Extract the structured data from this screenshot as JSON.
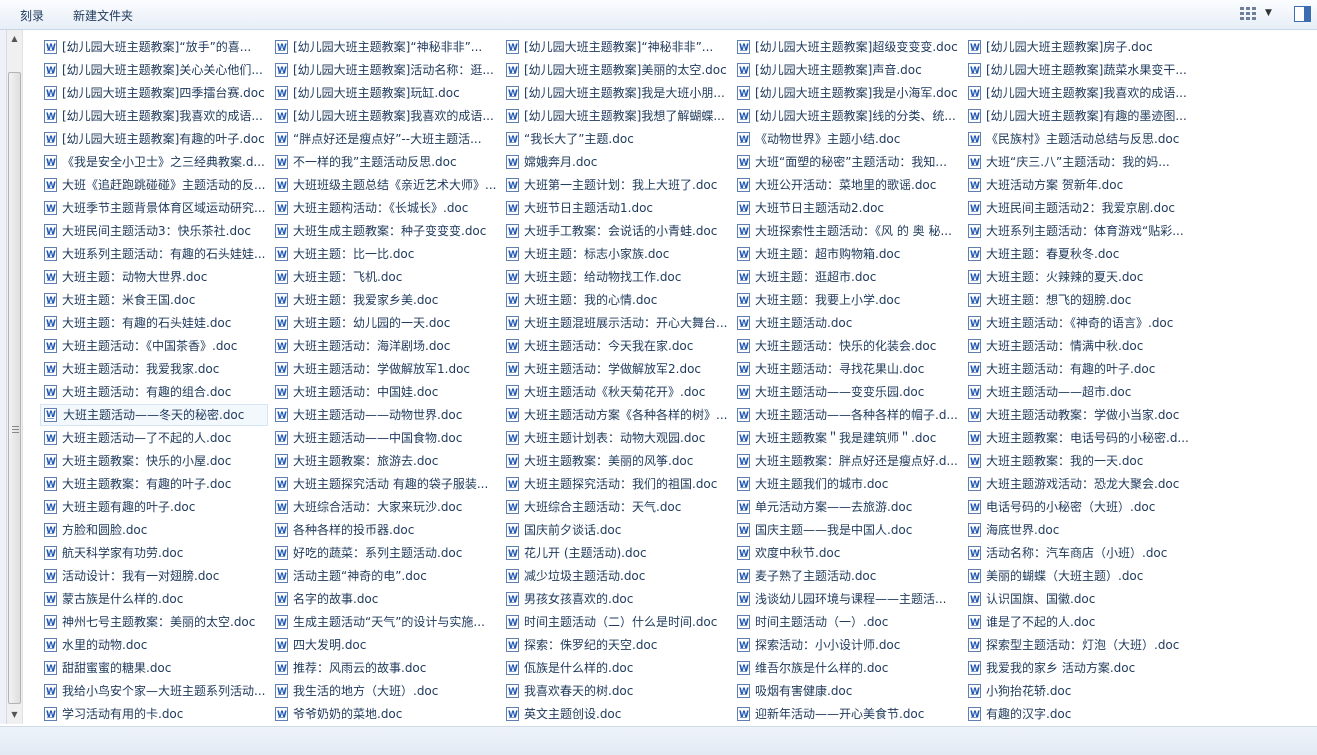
{
  "toolbar": {
    "burn_label": "刻录",
    "new_folder_label": "新建文件夹",
    "view_icon": "grid-view-icon",
    "view_menu_icon": "chevron-down-icon",
    "preview_pane_icon": "preview-pane-icon"
  },
  "selected_index": 16,
  "files": [
    "[幼儿园大班主题教案]“放手”的喜...",
    "[幼儿园大班主题教案]关心关心他们...",
    "[幼儿园大班主题教案]四季擂台赛.doc",
    "[幼儿园大班主题教案]我喜欢的成语...",
    "[幼儿园大班主题教案]有趣的叶子.doc",
    "《我是安全小卫士》之三经典教案.d...",
    "大班《追赶跑跳碰碰》主题活动的反...",
    "大班季节主题背景体育区域运动研究...",
    "大班民间主题活动3：快乐茶社.doc",
    "大班系列主题活动：有趣的石头娃娃...",
    "大班主题：动物大世界.doc",
    "大班主题：米食王国.doc",
    "大班主题：有趣的石头娃娃.doc",
    "大班主题活动：《中国茶香》.doc",
    "大班主题活动：我爱我家.doc",
    "大班主题活动：有趣的组合.doc",
    "大班主题活动——冬天的秘密.doc",
    "大班主题活动—了不起的人.doc",
    "大班主题教案：快乐的小屋.doc",
    "大班主题教案：有趣的叶子.doc",
    "大班主题有趣的叶子.doc",
    "方脸和圆脸.doc",
    "航天科学家有功劳.doc",
    "活动设计：我有一对翅膀.doc",
    "蒙古族是什么样的.doc",
    "神州七号主题教案：美丽的太空.doc",
    "水里的动物.doc",
    "甜甜蜜蜜的糖果.doc",
    "我给小鸟安个家—大班主题系列活动...",
    "学习活动有用的卡.doc",
    "[幼儿园大班主题教案]“神秘非非”...",
    "[幼儿园大班主题教案]活动名称：逛...",
    "[幼儿园大班主题教案]玩缸.doc",
    "[幼儿园大班主题教案]我喜欢的成语...",
    "“胖点好还是瘦点好”--大班主题活...",
    "不一样的我”主题活动反思.doc",
    "大班班级主题总结《亲近艺术大师》...",
    "大班主题构活动：《长城长》.doc",
    "大班生成主题教案：种子变变变.doc",
    "大班主题：比一比.doc",
    "大班主题：飞机.doc",
    "大班主题：我爱家乡美.doc",
    "大班主题：幼儿园的一天.doc",
    "大班主题活动：海洋剧场.doc",
    "大班主题活动：学做解放军1.doc",
    "大班主题活动：中国娃.doc",
    "大班主题活动——动物世界.doc",
    "大班主题活动——中国食物.doc",
    "大班主题教案：旅游去.doc",
    "大班主题探究活动 有趣的袋子服装...",
    "大班综合活动：大家来玩沙.doc",
    "各种各样的投币器.doc",
    "好吃的蔬菜：系列主题活动.doc",
    "活动主题“神奇的电”.doc",
    "名字的故事.doc",
    "生成主题活动“天气”的设计与实施...",
    "四大发明.doc",
    "推荐：风雨云的故事.doc",
    "我生活的地方（大班）.doc",
    "爷爷奶奶的菜地.doc",
    "[幼儿园大班主题教案]“神秘非非”...",
    "[幼儿园大班主题教案]美丽的太空.doc",
    "[幼儿园大班主题教案]我是大班小朋...",
    "[幼儿园大班主题教案]我想了解蝴蝶...",
    "“我长大了”主题.doc",
    "嫦娥奔月.doc",
    "大班第一主题计划：我上大班了.doc",
    "大班节日主题活动1.doc",
    "大班手工教案：会说话的小青蛙.doc",
    "大班主题：标志小家族.doc",
    "大班主题：给动物找工作.doc",
    "大班主题：我的心情.doc",
    "大班主题混班展示活动：开心大舞台...",
    "大班主题活动：今天我在家.doc",
    "大班主题活动：学做解放军2.doc",
    "大班主题活动《秋天菊花开》.doc",
    "大班主题活动方案《各种各样的树》...",
    "大班主题计划表：动物大观园.doc",
    "大班主题教案：美丽的风筝.doc",
    "大班主题探究活动：我们的祖国.doc",
    "大班综合主题活动：天气.doc",
    "国庆前夕谈话.doc",
    "花儿开 (主题活动).doc",
    "减少垃圾主题活动.doc",
    "男孩女孩喜欢的.doc",
    "时间主题活动（二）什么是时间.doc",
    "探索：侏罗纪的天空.doc",
    "佤族是什么样的.doc",
    "我喜欢春天的树.doc",
    "英文主题创设.doc",
    "[幼儿园大班主题教案]超级变变变.doc",
    "[幼儿园大班主题教案]声音.doc",
    "[幼儿园大班主题教案]我是小海军.doc",
    "[幼儿园大班主题教案]线的分类、统...",
    "《动物世界》主题小结.doc",
    "大班“面塑的秘密”主题活动：我知...",
    "大班公开活动：菜地里的歌谣.doc",
    "大班节日主题活动2.doc",
    "大班探索性主题活动：《风 的 奥 秘...",
    "大班主题：超市购物箱.doc",
    "大班主题：逛超市.doc",
    "大班主题：我要上小学.doc",
    "大班主题活动.doc",
    "大班主题活动：快乐的化装会.doc",
    "大班主题活动：寻找花果山.doc",
    "大班主题活动——变变乐园.doc",
    "大班主题活动——各种各样的帽子.d...",
    "大班主题教案＂我是建筑师＂.doc",
    "大班主题教案：胖点好还是瘦点好.d...",
    "大班主题我们的城市.doc",
    "单元活动方案——去旅游.doc",
    "国庆主题——我是中国人.doc",
    "欢度中秋节.doc",
    "麦子熟了主题活动.doc",
    "浅谈幼儿园环境与课程——主题活...",
    "时间主题活动（一）.doc",
    "探索活动：小小设计师.doc",
    "维吾尔族是什么样的.doc",
    "吸烟有害健康.doc",
    "迎新年活动——开心美食节.doc",
    "[幼儿园大班主题教案]房子.doc",
    "[幼儿园大班主题教案]蔬菜水果变干...",
    "[幼儿园大班主题教案]我喜欢的成语...",
    "[幼儿园大班主题教案]有趣的墨迹图...",
    "《民族村》主题活动总结与反思.doc",
    "大班“庆三.八”主题活动：我的妈...",
    "大班活动方案 贺新年.doc",
    "大班民间主题活动2：我爱京剧.doc",
    "大班系列主题活动：体育游戏“贴彩...",
    "大班主题：春夏秋冬.doc",
    "大班主题：火辣辣的夏天.doc",
    "大班主题：想飞的翅膀.doc",
    "大班主题活动：《神奇的语言》.doc",
    "大班主题活动：情满中秋.doc",
    "大班主题活动：有趣的叶子.doc",
    "大班主题活动——超市.doc",
    "大班主题活动教案：学做小当家.doc",
    "大班主题教案：电话号码的小秘密.d...",
    "大班主题教案：我的一天.doc",
    "大班主题游戏活动：恐龙大聚会.doc",
    "电话号码的小秘密（大班）.doc",
    "海底世界.doc",
    "活动名称：汽车商店（小班）.doc",
    "美丽的蝴蝶（大班主题）.doc",
    "认识国旗、国徽.doc",
    "谁是了不起的人.doc",
    "探索型主题活动：灯泡（大班）.doc",
    "我爱我的家乡 活动方案.doc",
    "小狗抬花轿.doc",
    "有趣的汉字.doc"
  ]
}
